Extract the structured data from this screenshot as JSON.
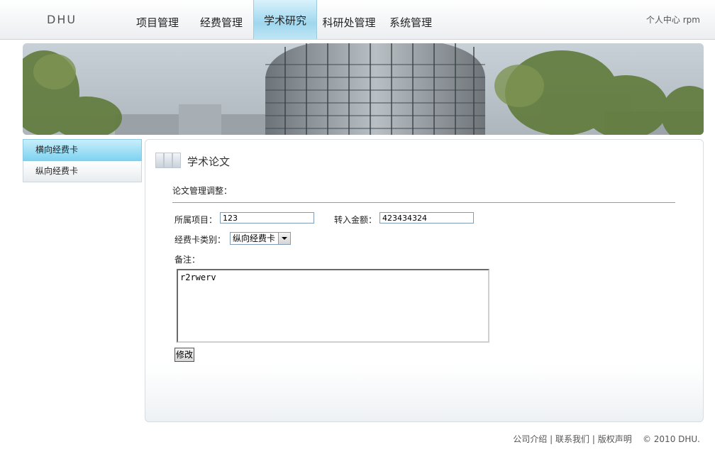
{
  "app": {
    "logo": "DHU"
  },
  "nav": {
    "items": [
      "项目管理",
      "经费管理",
      "学术研究",
      "科研处管理",
      "系统管理"
    ],
    "active": "学术研究"
  },
  "user": {
    "center": "个人中心",
    "name": "rpm"
  },
  "sidebar": {
    "items": [
      "横向经费卡",
      "纵向经费卡"
    ],
    "active": "横向经费卡"
  },
  "panel": {
    "title": "学术论文",
    "section": "论文管理调整："
  },
  "form": {
    "project_label": "所属项目：",
    "project_value": "123",
    "amount_label": "转入金额：",
    "amount_value": "423434324",
    "card_type_label": "经费卡类别：",
    "card_type_value": "纵向经费卡",
    "note_label": "备注：",
    "note_value": "r2rwerv",
    "submit_label": "修改"
  },
  "footer": {
    "links": [
      "公司介绍",
      "联系我们",
      "版权声明"
    ],
    "separator": "|",
    "copyright": "© 2010 DHU."
  }
}
